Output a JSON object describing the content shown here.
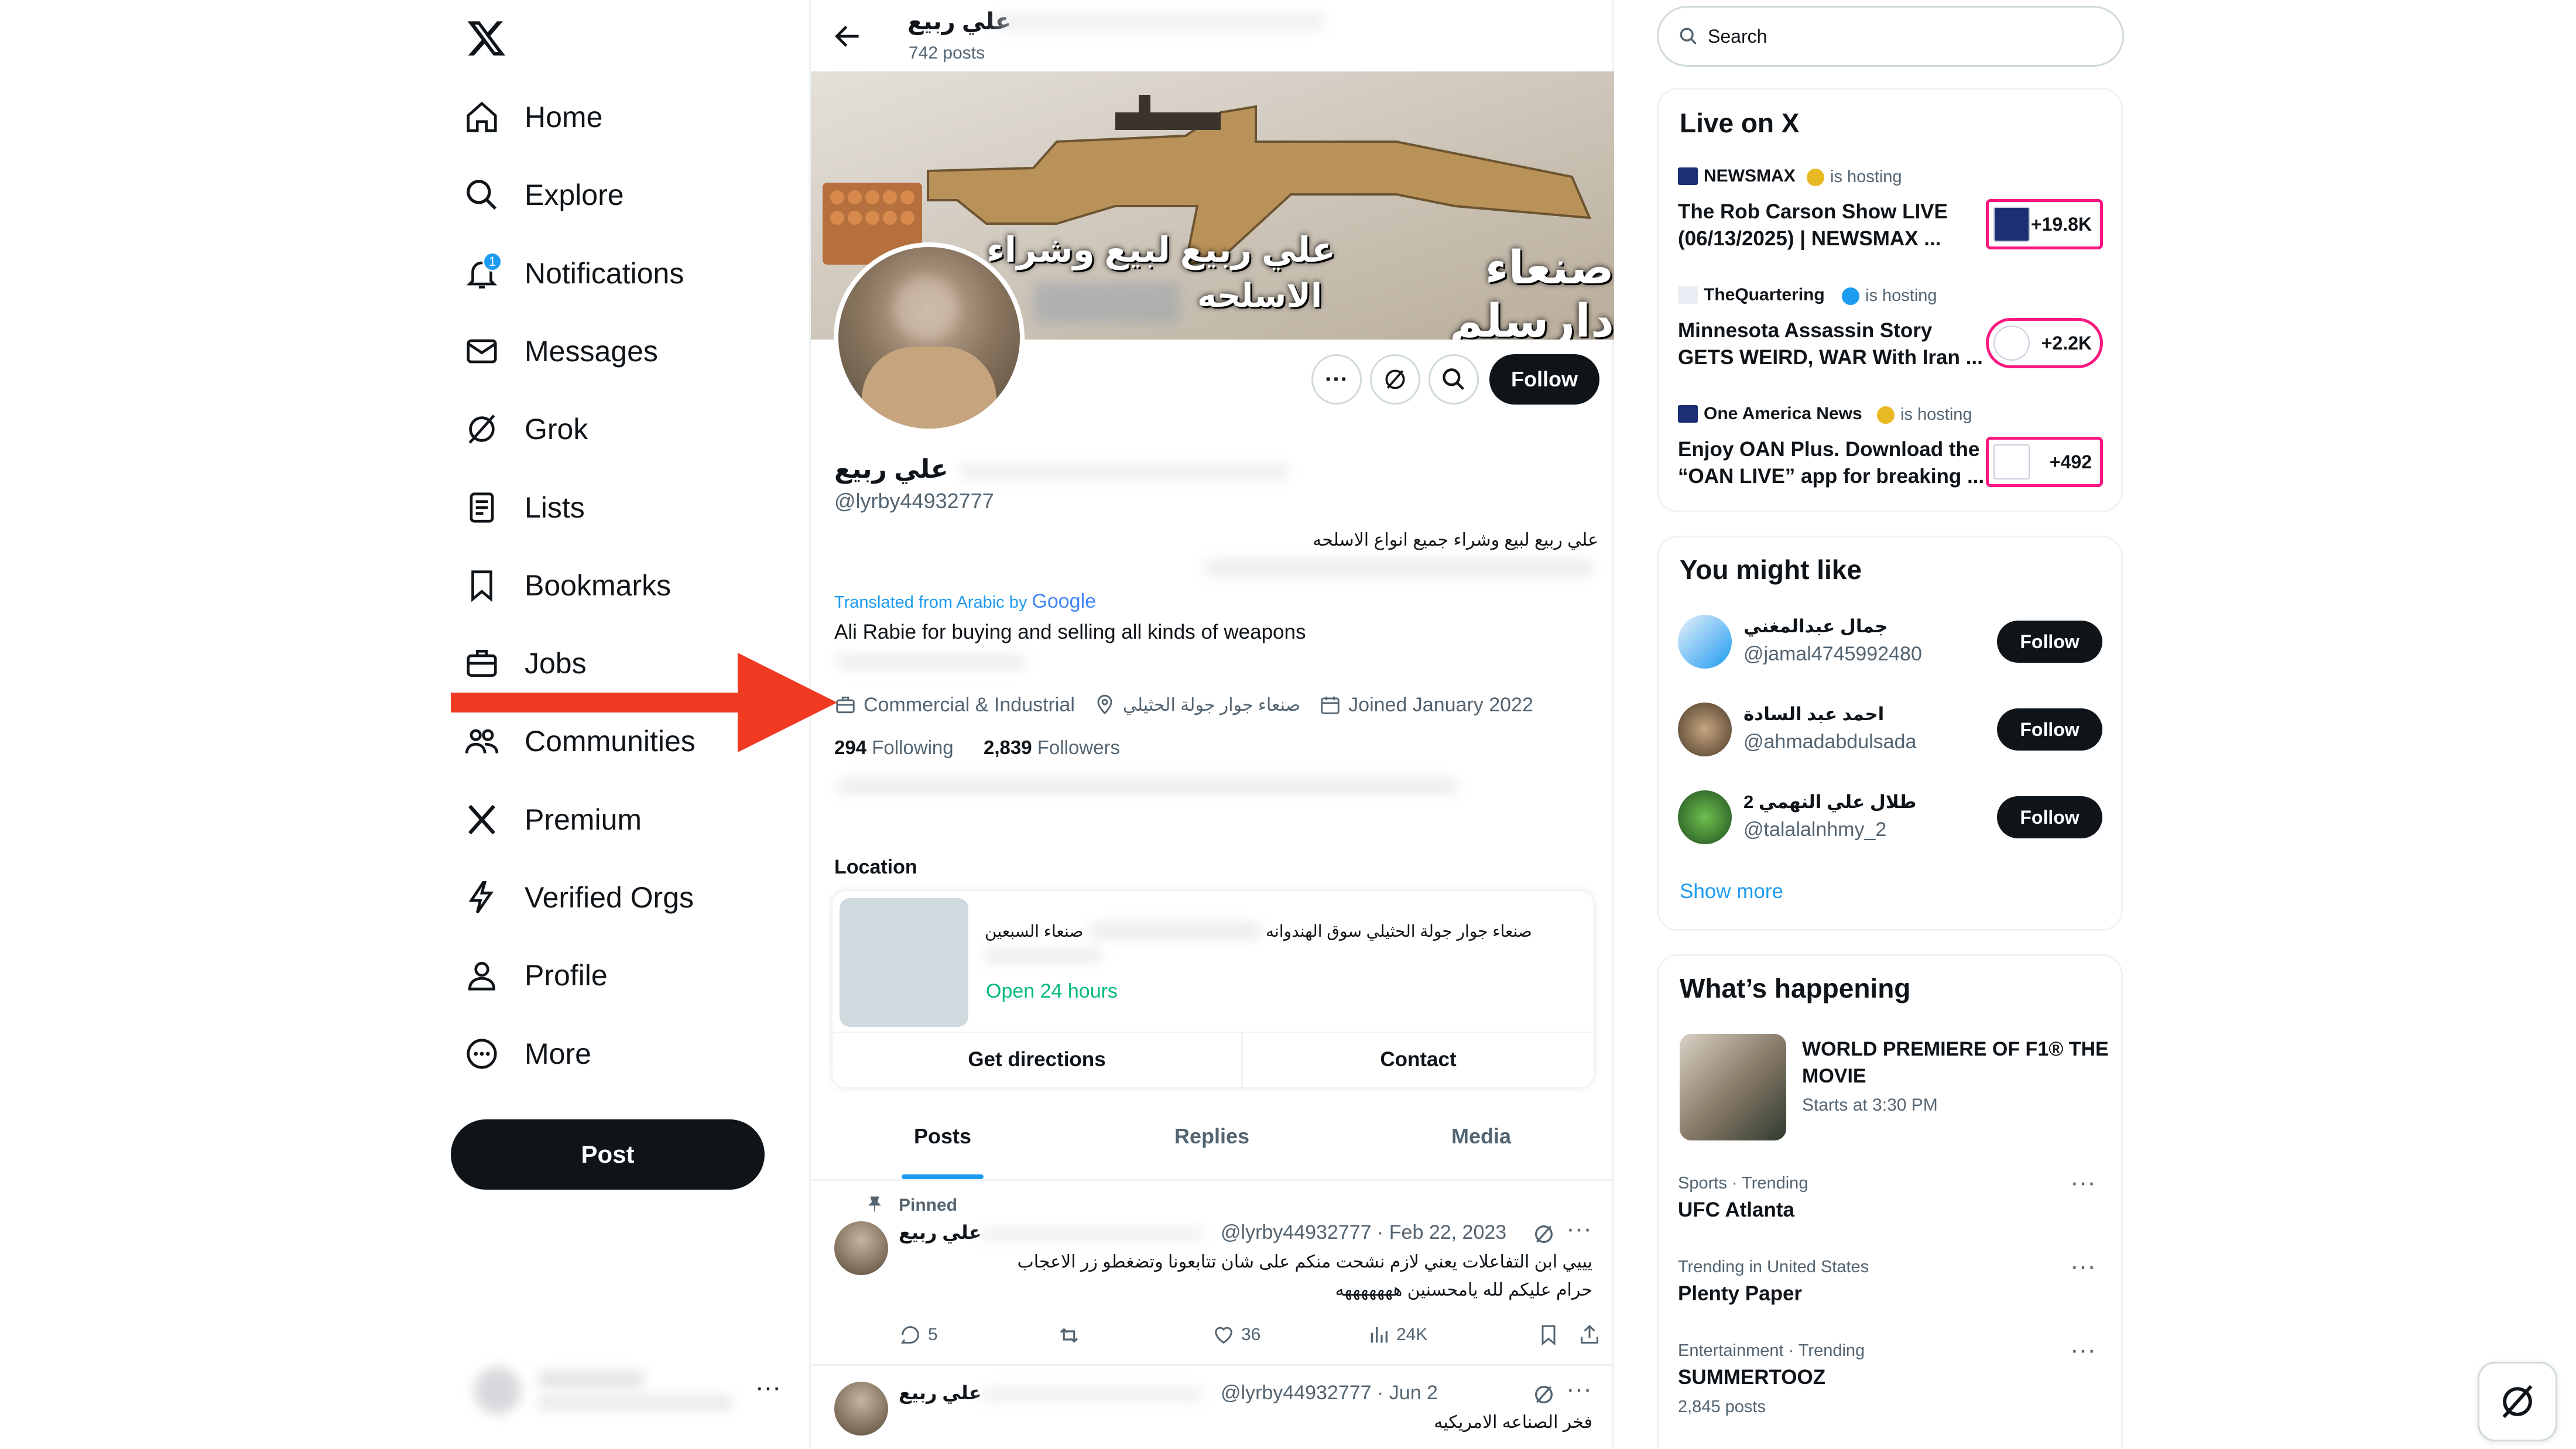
{
  "nav": {
    "items": [
      {
        "label": "Home",
        "icon": "home-icon"
      },
      {
        "label": "Explore",
        "icon": "search-icon"
      },
      {
        "label": "Notifications",
        "icon": "bell-icon"
      },
      {
        "label": "Messages",
        "icon": "mail-icon"
      },
      {
        "label": "Grok",
        "icon": "grok-icon"
      },
      {
        "label": "Lists",
        "icon": "list-icon"
      },
      {
        "label": "Bookmarks",
        "icon": "bookmark-icon"
      },
      {
        "label": "Jobs",
        "icon": "briefcase-icon"
      },
      {
        "label": "Communities",
        "icon": "people-icon"
      },
      {
        "label": "Premium",
        "icon": "x-logo-icon"
      },
      {
        "label": "Verified Orgs",
        "icon": "lightning-icon"
      },
      {
        "label": "Profile",
        "icon": "person-icon"
      },
      {
        "label": "More",
        "icon": "more-circle-icon"
      }
    ],
    "notification_count": "1",
    "post_label": "Post"
  },
  "header": {
    "name": "علي ربيع",
    "posts_count": "742 posts"
  },
  "banner": {
    "text_line1": "صنعاء دارسلم",
    "text_line2": "علي ربيع لبيع وشراء",
    "text_line3": "الاسلحه"
  },
  "profile": {
    "name": "علي ربيع",
    "handle": "@lyrby44932777",
    "follow_label": "Follow",
    "bio_ar": "علي ربيع لبيع وشراء جميع انواع الاسلحه",
    "translated_label": "Translated from Arabic by",
    "google": "Google",
    "bio_en": "Ali Rabie for buying and selling all kinds of weapons",
    "category": "Commercial & Industrial",
    "location": "صنعاء جوار جولة الحثيلي",
    "joined": "Joined January 2022",
    "following_count": "294",
    "following_label": "Following",
    "followers_count": "2,839",
    "followers_label": "Followers"
  },
  "location_card": {
    "title": "Location",
    "address": "صنعاء جوار جولة الحثيلي سوق الهندوانه",
    "address2": "صنعاء السبعين",
    "hours": "Open 24 hours",
    "directions_label": "Get directions",
    "contact_label": "Contact"
  },
  "tabs": [
    "Posts",
    "Replies",
    "Media"
  ],
  "posts": [
    {
      "pinned_label": "Pinned",
      "name": "علي ربيع",
      "meta": "@lyrby44932777 · Feb 22, 2023",
      "text1": "يييي ابن التفاعلات يعني لازم نشحت منكم على شان تتابعونا وتضغطو  زر الاعجاب",
      "text2": "حرام عليكم لله يامحسنين هههههههه",
      "replies": "5",
      "likes": "36",
      "views": "24K"
    },
    {
      "name": "علي ربيع",
      "meta": "@lyrby44932777 · Jun 2",
      "text1": "فخر الصناعه الامريكيه"
    }
  ],
  "search": {
    "placeholder": "Search"
  },
  "live": {
    "title": "Live on X",
    "is_hosting": "is hosting",
    "items": [
      {
        "host": "NEWSMAX",
        "title1": "The Rob Carson Show LIVE",
        "title2": "(06/13/2025) | NEWSMAX ...",
        "count": "+19.8K"
      },
      {
        "host": "TheQuartering",
        "title1": "Minnesota Assassin Story",
        "title2": "GETS WEIRD, WAR With Iran ...",
        "count": "+2.2K"
      },
      {
        "host": "One America News",
        "title1": "Enjoy OAN Plus. Download the",
        "title2": "“OAN LIVE” app for breaking ...",
        "count": "+492"
      }
    ]
  },
  "suggest": {
    "title": "You might like",
    "follow_label": "Follow",
    "show_more": "Show more",
    "users": [
      {
        "name": "جمال عبدالمغني",
        "handle": "@jamal4745992480"
      },
      {
        "name": "احمد عبد السادة",
        "handle": "@ahmadabdulsada"
      },
      {
        "name": "طلال علي النهمي 2",
        "handle": "@talalalnhmy_2"
      }
    ]
  },
  "happening": {
    "title": "What’s happening",
    "event_title1": "WORLD PREMIERE OF F1® THE",
    "event_title2": "MOVIE",
    "event_time": "Starts at 3:30 PM",
    "trends": [
      {
        "context": "Sports · Trending",
        "name": "UFC Atlanta",
        "extra": ""
      },
      {
        "context": "Trending in United States",
        "name": "Plenty Paper",
        "extra": ""
      },
      {
        "context": "Entertainment · Trending",
        "name": "SUMMERTOOZ",
        "extra": "2,845 posts"
      }
    ]
  },
  "colors": {
    "accent": "#1d9bf0",
    "arrow": "#f03a22",
    "live": "#f91880",
    "green": "#00ba7c"
  }
}
